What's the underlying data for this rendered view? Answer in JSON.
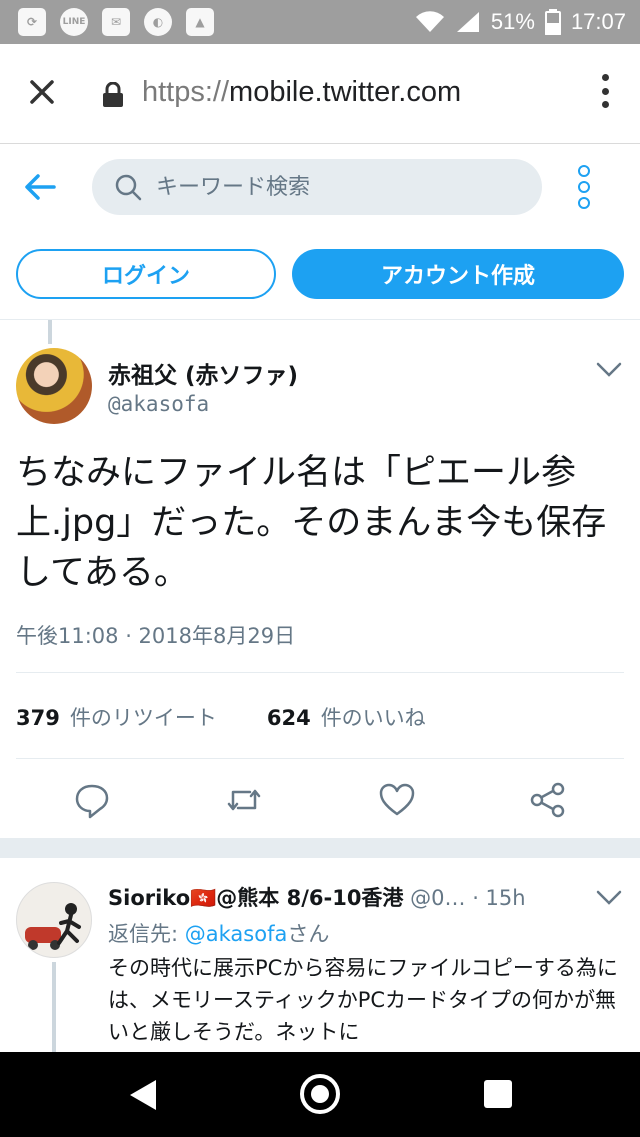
{
  "status_bar": {
    "battery": "51%",
    "time": "17:07",
    "notification_icons": [
      "sync-icon",
      "line-icon",
      "gmail-icon",
      "app-icon",
      "image-icon"
    ],
    "line_label": "LINE"
  },
  "browser": {
    "url_scheme": "https://",
    "url_host": "mobile.twitter.com"
  },
  "header": {
    "search_placeholder": "キーワード検索",
    "login_label": "ログイン",
    "signup_label": "アカウント作成",
    "accent_color": "#1da1f2"
  },
  "tweet": {
    "display_name": "赤祖父 (赤ソファ)",
    "handle": "@akasofa",
    "text": "ちなみにファイル名は「ピエール参上.jpg」だった。そのまんま今も保存してある。",
    "timestamp": "午後11:08 · 2018年8月29日",
    "retweets_count": "379",
    "retweets_label": "件のリツイート",
    "likes_count": "624",
    "likes_label": "件のいいね"
  },
  "reply": {
    "display_name": "Sioriko🇭🇰@熊本 8/6-10香港",
    "handle": "@0…",
    "time": "15h",
    "reply_to_prefix": "返信先: ",
    "reply_to_mention": "@akasofa",
    "reply_to_suffix": "さん",
    "text": "その時代に展示PCから容易にファイルコピーする為には、メモリースティックかPCカードタイプの何かが無いと厳しそうだ。ネットに"
  }
}
